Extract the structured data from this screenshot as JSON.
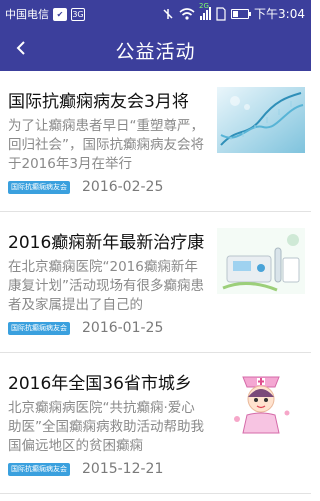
{
  "status_bar": {
    "carrier": "中国电信",
    "badge_3g": "3G",
    "network": "2G",
    "time": "下午3:04"
  },
  "header": {
    "back_glyph": "‹",
    "title": "公益活动"
  },
  "articles": [
    {
      "title": "国际抗癫痫病友会3月将",
      "summary": "为了让癫痫患者早日“重塑尊严，回归社会”，国际抗癫痫病友会将于2016年3月在举行",
      "tag": "国际抗癫痫病友会",
      "date": "2016-02-25",
      "image": "dna-helix"
    },
    {
      "title": "2016癫痫新年最新治疗康",
      "summary": "在北京癫痫医院“2016癫痫新年康复计划”活动现场有很多癫痫患者及家属提出了自己的",
      "tag": "国际抗癫痫病友会",
      "date": "2016-01-25",
      "image": "medical-equipment"
    },
    {
      "title": "2016年全国36省市城乡",
      "summary": "北京癫痫病医院“共抗癫痫·爱心助医”全国癫痫病救助活动帮助我国偏远地区的贫困癫痫",
      "tag": "国际抗癫痫病友会",
      "date": "2015-12-21",
      "image": "nurse-cartoon"
    }
  ],
  "colors": {
    "primary": "#3c3f9c",
    "tag": "#3aa0de",
    "summary_text": "#8a8a8a"
  }
}
